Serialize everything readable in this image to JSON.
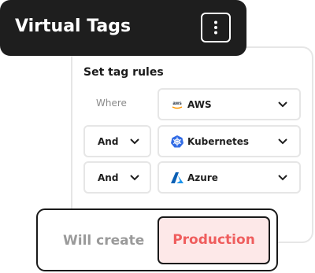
{
  "title_bar": {
    "title": "Virtual Tags",
    "menu_icon": "more-vertical-icon"
  },
  "rules": {
    "heading": "Set tag rules",
    "rows": [
      {
        "operator": "Where",
        "operator_is_select": false,
        "provider": "AWS",
        "provider_icon": "aws-logo-icon"
      },
      {
        "operator": "And",
        "operator_is_select": true,
        "provider": "Kubernetes",
        "provider_icon": "kubernetes-logo-icon"
      },
      {
        "operator": "And",
        "operator_is_select": true,
        "provider": "Azure",
        "provider_icon": "azure-logo-icon"
      }
    ]
  },
  "result": {
    "label": "Will create",
    "value": "Production"
  },
  "colors": {
    "dark": "#1e1e1e",
    "production_bg": "#fde8e8",
    "production_text": "#ef5d5d",
    "kubernetes_blue": "#326ce5",
    "azure_blue": "#0078d4"
  }
}
